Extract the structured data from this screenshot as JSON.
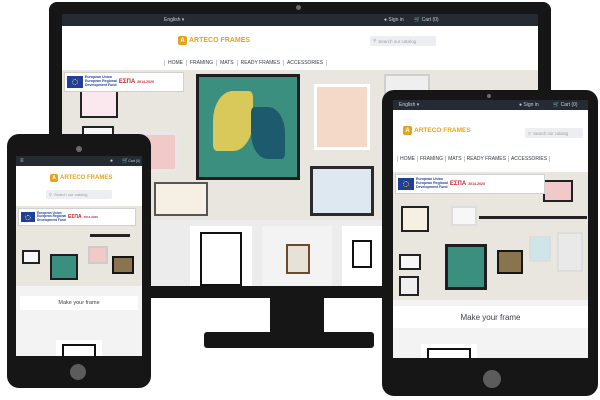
{
  "site": {
    "language": "English ▾",
    "sign_in": "Sign in",
    "cart": "Cart (0)",
    "logo_text": "ARTECO FRAMES",
    "search_placeholder": "Search our catalog",
    "nav": [
      "HOME",
      "FRAMING",
      "MATS",
      "READY FRAMES",
      "ACCESSORIES"
    ],
    "eu_banner": {
      "line1": "European Union",
      "line2": "European Regional",
      "line3": "Development Fund",
      "program": "ΕΣΠΑ",
      "years": "2014-2020"
    },
    "make_your_frame": "Make your frame"
  },
  "colors": {
    "device_body": "#161616",
    "topbar": "#252b33",
    "brand_orange": "#e8a21a",
    "hero_wall": "#e9e6df"
  },
  "icons": [
    "user-icon",
    "cart-icon",
    "search-icon",
    "menu-icon"
  ]
}
